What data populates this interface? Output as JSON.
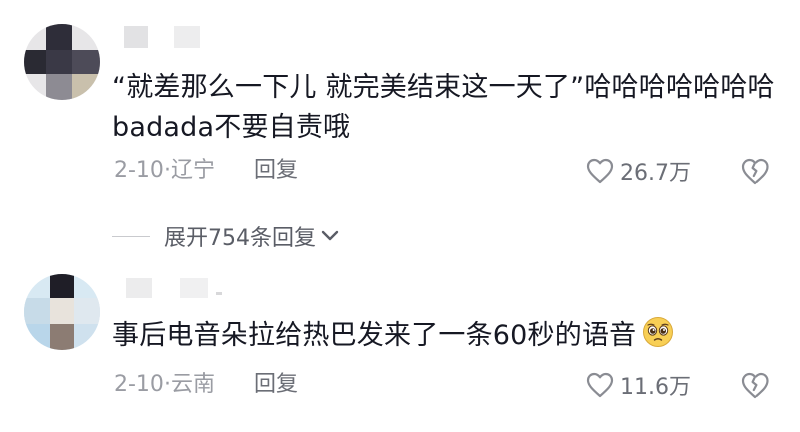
{
  "comments": [
    {
      "text": "“就差那么一下儿 就完美结束这一天了”哈哈哈哈哈哈哈badada不要自责哦",
      "date": "2-10",
      "location": "辽宁",
      "reply_label": "回复",
      "likes": "26.7万",
      "reply_toggle_label": "展开754条回复"
    },
    {
      "text": "事后电音朵拉给热巴发来了一条60秒的语音",
      "date": "2-10",
      "location": "云南",
      "reply_label": "回复",
      "likes": "11.6万"
    }
  ],
  "colors": {
    "text_primary": "#161823",
    "text_secondary": "#9a9ca3",
    "reply": "#6b6e76"
  },
  "icons": [
    "heart-icon",
    "broken-heart-icon",
    "chevron-down-icon",
    "pleading-face-emoji-icon"
  ]
}
